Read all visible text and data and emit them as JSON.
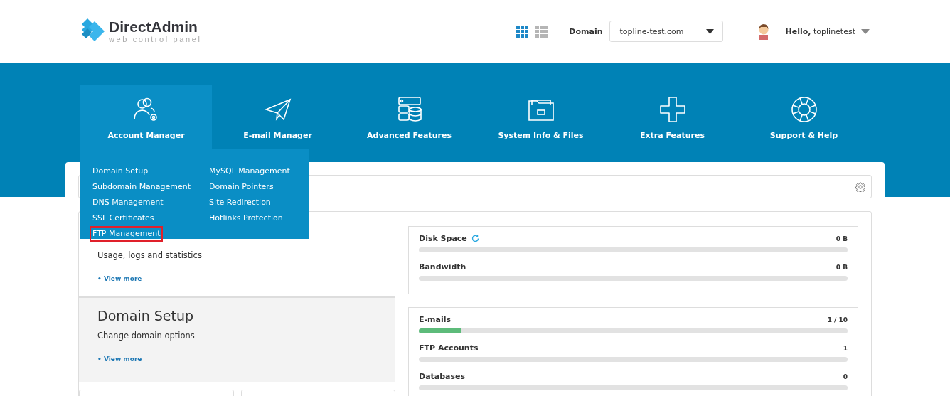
{
  "header": {
    "logo_name": "DirectAdmin",
    "logo_tagline": "web control panel",
    "view_modes": [
      {
        "kind": "grid",
        "selected": true
      },
      {
        "kind": "list",
        "selected": false
      }
    ],
    "domain_label": "Domain",
    "domain_value": "topline-test.com",
    "greeting": "Hello,",
    "username": "toplinetest"
  },
  "nav": [
    {
      "kind": "users",
      "label": "Account Manager",
      "selected": true
    },
    {
      "kind": "plane",
      "label": "E-mail Manager",
      "selected": false
    },
    {
      "kind": "server",
      "label": "Advanced Features",
      "selected": false
    },
    {
      "kind": "folder",
      "label": "System Info & Files",
      "selected": false
    },
    {
      "kind": "plus",
      "label": "Extra Features",
      "selected": false
    },
    {
      "kind": "lifebuoy",
      "label": "Support & Help",
      "selected": false
    }
  ],
  "dropdown": {
    "columns": [
      [
        {
          "label": "Domain Setup",
          "highlighted": false
        },
        {
          "label": "Subdomain Management",
          "highlighted": false
        },
        {
          "label": "DNS Management",
          "highlighted": false
        },
        {
          "label": "SSL Certificates",
          "highlighted": false
        },
        {
          "label": "FTP Management",
          "highlighted": true
        }
      ],
      [
        {
          "label": "MySQL Management",
          "highlighted": false
        },
        {
          "label": "Domain Pointers",
          "highlighted": false
        },
        {
          "label": "Site Redirection",
          "highlighted": false
        },
        {
          "label": "Hotlinks Protection",
          "highlighted": false
        }
      ]
    ]
  },
  "cards": [
    {
      "description": "Usage, logs and statistics",
      "link": "• View more",
      "shaded": false
    },
    {
      "title": "Domain Setup",
      "description": "Change domain options",
      "link": "• View more",
      "shaded": true
    }
  ],
  "stat_groups": [
    [
      {
        "label": "Disk Space",
        "value": "0 B",
        "loading": true
      },
      {
        "label": "Bandwidth",
        "value": "0 B"
      }
    ],
    [
      {
        "label": "E-mails",
        "value": "1 / 10",
        "level": 0.1
      },
      {
        "label": "FTP Accounts",
        "value": "1"
      },
      {
        "label": "Databases",
        "value": "0"
      }
    ]
  ]
}
